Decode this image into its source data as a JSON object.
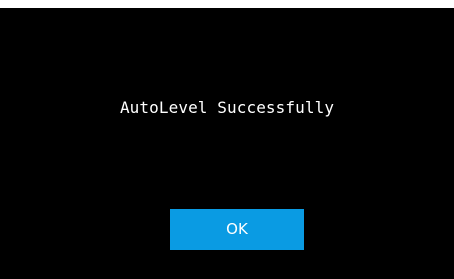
{
  "dialog": {
    "message": "AutoLevel Successfully",
    "ok_label": "OK"
  },
  "colors": {
    "background": "#000000",
    "text": "#ffffff",
    "button": "#0a9be3"
  }
}
